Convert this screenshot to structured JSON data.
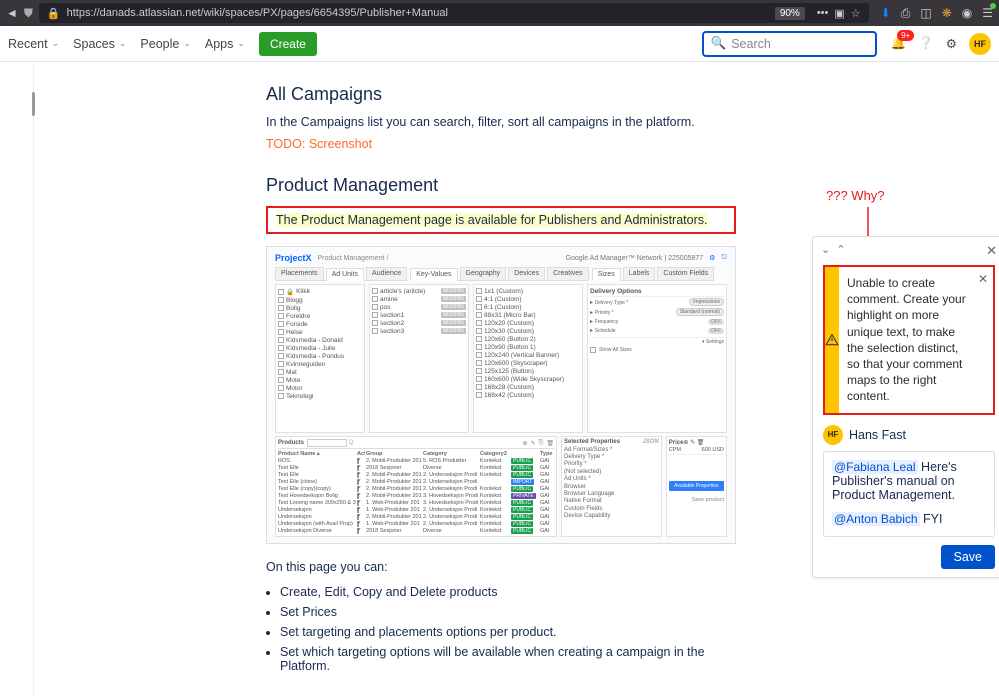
{
  "browser": {
    "url": "https://danads.atlassian.net/wiki/spaces/PX/pages/6654395/Publisher+Manual",
    "zoom": "90%"
  },
  "conf_nav": {
    "recent": "Recent",
    "spaces": "Spaces",
    "people": "People",
    "apps": "Apps",
    "create": "Create",
    "search_placeholder": "Search",
    "bell_count": "9+",
    "avatar_initials": "HF"
  },
  "doc": {
    "h_campaigns": "All Campaigns",
    "p_campaigns": "In the Campaigns list you can search, filter, sort all campaigns in the platform.",
    "todo": "TODO: Screenshot",
    "h_pm": "Product Management",
    "highlight": "The Product Management page is available for Publishers and Administrators.",
    "after": "On this page you can:",
    "bullets": [
      "Create, Edit, Copy and Delete products",
      "Set Prices",
      "Set targeting and placements options per product.",
      "Set which targeting options will be available when creating a campaign in the Platform."
    ]
  },
  "embed": {
    "brand": "ProjectX",
    "crumb": "Product Management /",
    "gam": "Google Ad Manager™ Network | 225005877",
    "tabs": {
      "placements": "Placements",
      "adunits": "Ad Units",
      "audience": "Audience",
      "kv": "Key-Values",
      "geo": "Geography",
      "dev": "Devices",
      "creat": "Creatives",
      "sizes": "Sizes",
      "labels": "Labels",
      "custom": "Custom Fields"
    },
    "col_adunits": [
      "Klikk",
      "Blogg",
      "Bolig",
      "Foreldre",
      "Forside",
      "Helse",
      "Kidsmedia - Donald",
      "Kidsmedia - Julie",
      "Kidsmedia - Pondus",
      "Kvinneguiden",
      "Mat",
      "Mote",
      "Motor",
      "Teknologi"
    ],
    "col_kv": [
      "article's (aritcle)",
      "amine",
      "pos",
      "section1",
      "section2",
      "section3"
    ],
    "col_sizes": [
      "1x1 (Custom)",
      "4:1 (Custom)",
      "6:1 (Custom)",
      "88x31 (Micro Bar)",
      "120x20 (Custom)",
      "120x30 (Custom)",
      "120x60 (Button 2)",
      "120x90 (Button 1)",
      "120x240 (Vertical Banner)",
      "120x600 (Skyscraper)",
      "125x125 (Button)",
      "160x600 (Wide Skyscraper)",
      "168x28 (Custom)",
      "168x42 (Custom)"
    ],
    "delivery": {
      "head": "Delivery Options",
      "type": "Delivery Type *",
      "type_val": "Impressions",
      "prio": "Priority *",
      "prio_val": "Standard (normal)",
      "freq": "Frequency",
      "sched": "Schedule",
      "settings": "Settings",
      "show_all": "Show All Sizes"
    },
    "products": {
      "title": "Products",
      "headers": [
        "Product Name",
        "Act.",
        "Group",
        "Category",
        "Category2",
        "Type"
      ],
      "rows": [
        {
          "name": "ROS",
          "grp": "2. Mobil-Produkter 201",
          "cat": "5. ROS Produkter",
          "cat2": "Kontekst",
          "tag": "pub",
          "tagt": "PUBLIC",
          "t": "GAI"
        },
        {
          "name": "Test Elle",
          "grp": "2018 Sesjoner",
          "cat": "Diverse",
          "cat2": "Kontekst",
          "tag": "pub",
          "tagt": "PUBLIC",
          "t": "GAI"
        },
        {
          "name": "Test Elle",
          "grp": "2. Mobil-Produkter 201",
          "cat": "2. Underseksjon Prodi",
          "cat2": "Kontekst",
          "tag": "pub",
          "tagt": "PUBLIC",
          "t": "GAI"
        },
        {
          "name": "Test Elle (clone)",
          "grp": "2. Mobil-Produkter 201",
          "cat": "2. Underseksjon Prodi",
          "cat2": "",
          "tag": "imp",
          "tagt": "IMPORT",
          "t": "GAI"
        },
        {
          "name": "Test Elle (copy)(copy)",
          "grp": "2. Mobil-Produkter 201",
          "cat": "2. Underseksjon Prodi",
          "cat2": "Kontekst",
          "tag": "pub",
          "tagt": "PUBLIC",
          "t": "GAI"
        },
        {
          "name": "Test Hovedseksjon Bolig",
          "grp": "2. Mobil-Produkter 201",
          "cat": "3. Hovedseksjon Prodi",
          "cat2": "Kontekst",
          "tag": "prv",
          "tagt": "PRIVATE",
          "t": "GAI"
        },
        {
          "name": "Test Looong name 300x250 & 300x6",
          "grp": "1. Web-Produkter 201",
          "cat": "3. Hovedseksjon Prodi",
          "cat2": "Kontekst",
          "tag": "pub",
          "tagt": "PUBLIC",
          "t": "GAI"
        },
        {
          "name": "Underseksjon",
          "grp": "1. Web-Produkter 201",
          "cat": "2. Underseksjon Prodi",
          "cat2": "Kontekst",
          "tag": "pub",
          "tagt": "PUBLIC",
          "t": "GAI"
        },
        {
          "name": "Underseksjon",
          "grp": "2. Mobil-Produkter 201",
          "cat": "2. Underseksjon Prodi",
          "cat2": "Kontekst",
          "tag": "pub",
          "tagt": "PUBLIC",
          "t": "GAI"
        },
        {
          "name": "Underseksjon (with Avail Prop)",
          "grp": "1. Web-Produkter 201",
          "cat": "2. Underseksjon Prodi",
          "cat2": "Kontekst",
          "tag": "pub",
          "tagt": "PUBLIC",
          "t": "GAI"
        },
        {
          "name": "Underseksjon Diverse",
          "grp": "2018 Sesjoner",
          "cat": "Diverse",
          "cat2": "Kontekst",
          "tag": "pub",
          "tagt": "PUBLIC",
          "t": "GAI"
        }
      ]
    },
    "selprops": {
      "title": "Selected Properties",
      "rows": [
        "Ad Format/Sizes *",
        "Delivery Type *",
        "Priority *",
        "(Not selected)",
        "Ad Units *",
        "Browser",
        "Browser Language",
        "Native Format",
        "Custom Fields",
        "Device Capability"
      ]
    },
    "price": {
      "title": "Price",
      "cpm": "CPM",
      "val": "600 USD",
      "avail": "Available Properties",
      "save": "Save product"
    }
  },
  "annot": {
    "why": "??? Why?"
  },
  "comment": {
    "error": "Unable to create comment. Create your highlight on more unique text, to make the selection distinct, so that your comment maps to the right content.",
    "author": "Hans Fast",
    "author_initials": "HF",
    "mention1": "@Fabiana Leal",
    "text1": " Here's Publisher's manual on Product Management.",
    "mention2": "@Anton Babich",
    "text2": " FYI",
    "save": "Save"
  }
}
